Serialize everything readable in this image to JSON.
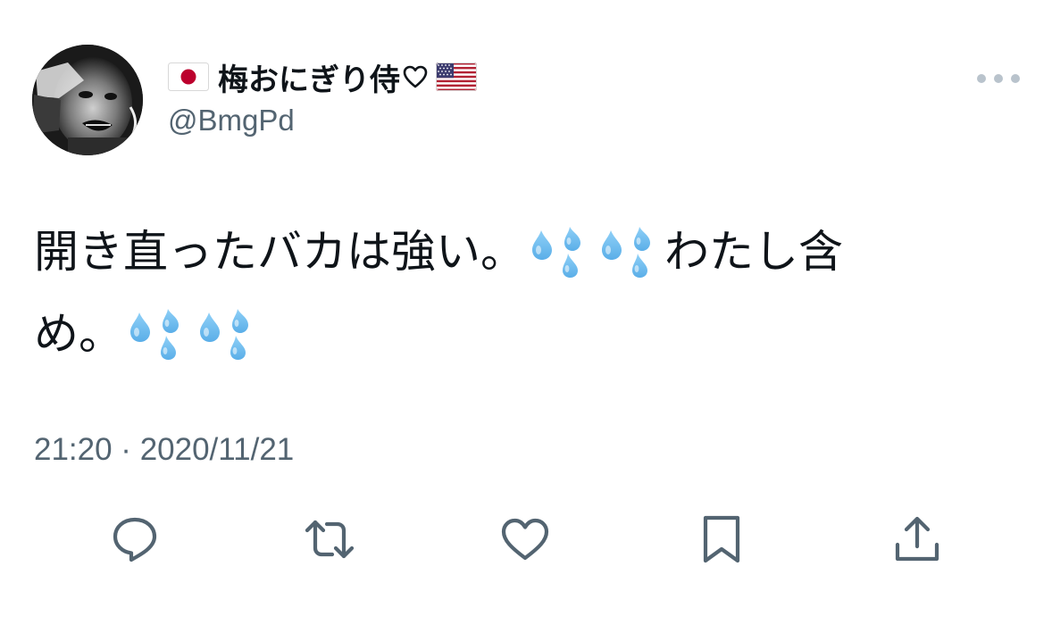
{
  "tweet": {
    "display_name_prefix_icon": "japan-flag-icon",
    "display_name": "梅おにぎり侍",
    "display_name_heart_icon": "white-heart-icon",
    "display_name_suffix_icon": "us-flag-icon",
    "handle": "@BmgPd",
    "body_line1_a": "開き直ったバカは強い。",
    "body_line1_b": "わたし含",
    "body_line2_a": "め。",
    "body_emoji_icon": "sweat-droplets-icon",
    "timestamp": "21:20 · 2020/11/21"
  },
  "actions": [
    {
      "name": "reply",
      "icon": "reply-icon"
    },
    {
      "name": "retweet",
      "icon": "retweet-icon"
    },
    {
      "name": "like",
      "icon": "like-icon"
    },
    {
      "name": "bookmark",
      "icon": "bookmark-icon"
    },
    {
      "name": "share",
      "icon": "share-icon"
    }
  ],
  "colors": {
    "text_primary": "#0f1419",
    "text_secondary": "#536471",
    "icon_gray": "#536471",
    "more_dots": "#b9c3cc",
    "drop_blue": "#5aaee8"
  }
}
